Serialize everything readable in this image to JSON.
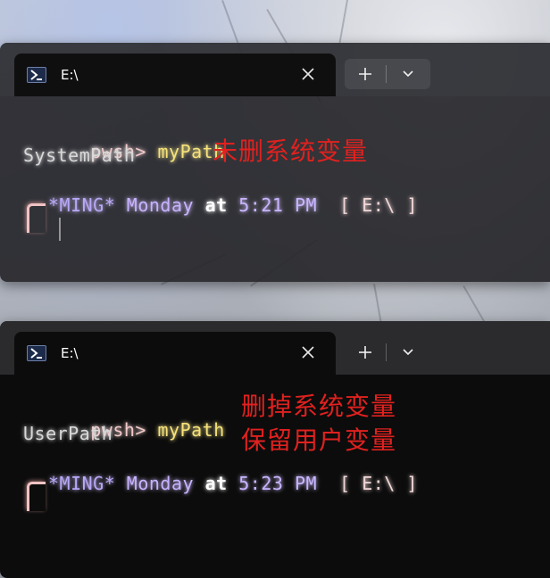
{
  "windows": [
    {
      "tab_title": "E:\\",
      "prompt": "pwsh>",
      "command": "myPath",
      "output": "SystemPath",
      "annotations": [
        "未删系统变量"
      ],
      "status": {
        "host": "*MING*",
        "day": "Monday",
        "at": "at",
        "time": "5:21 PM",
        "path": "[ E:\\ ]"
      }
    },
    {
      "tab_title": "E:\\",
      "prompt": "pwsh>",
      "command": "myPath",
      "output": "UserPath",
      "annotations": [
        "删掉系统变量",
        "保留用户变量"
      ],
      "status": {
        "host": "*MING*",
        "day": "Monday",
        "at": "at",
        "time": "5:23 PM",
        "path": "[ E:\\ ]"
      }
    }
  ],
  "icons": {
    "tab": "powershell-icon",
    "close": "close-icon",
    "new_tab": "plus-icon",
    "dropdown": "chevron-down-icon"
  },
  "colors": {
    "annotation": "#e0211f",
    "prompt": "#f0c9c9",
    "command": "#f5e27a",
    "host": "#b9a8f5"
  }
}
